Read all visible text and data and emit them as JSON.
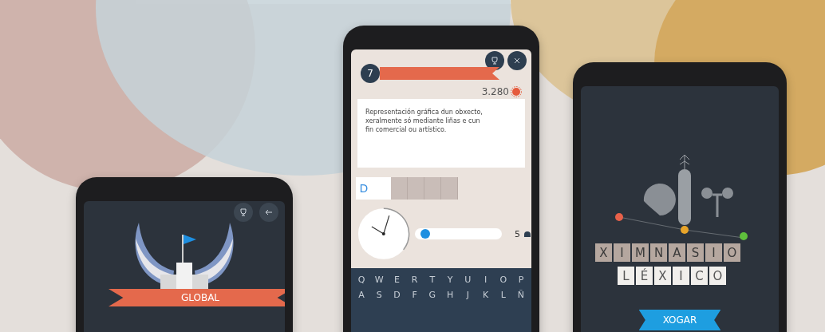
{
  "phones": [
    {
      "kind": "badge",
      "ribbon": "GLOBAL"
    },
    {
      "kind": "quiz",
      "round": "7",
      "score": "3.280",
      "clue": "Representación gráfica dun obxecto, xeralmente só mediante liñas e cun fin comercial ou artístico.",
      "answer_cells": [
        {
          "letter": "D",
          "kind": "typed"
        },
        {
          "kind": "current"
        },
        {
          "kind": "empty"
        },
        {
          "kind": "empty"
        },
        {
          "kind": "empty"
        },
        {
          "kind": "empty"
        }
      ],
      "timer": {
        "level": 0.12
      },
      "hints": "5",
      "keyboard": [
        [
          "Q",
          "W",
          "E",
          "R",
          "T",
          "Y",
          "U",
          "I",
          "O",
          "P"
        ],
        [
          "A",
          "S",
          "D",
          "F",
          "G",
          "H",
          "J",
          "K",
          "L",
          "Ñ"
        ]
      ]
    },
    {
      "kind": "game",
      "words": [
        {
          "kind": "shaded",
          "letters": [
            "X",
            "I",
            "M",
            "N",
            "A",
            "S",
            "I",
            "O"
          ]
        },
        {
          "kind": "plain",
          "letters": [
            "L",
            "É",
            "X",
            "I",
            "C",
            "O"
          ]
        }
      ],
      "button": "XOGAR"
    }
  ]
}
